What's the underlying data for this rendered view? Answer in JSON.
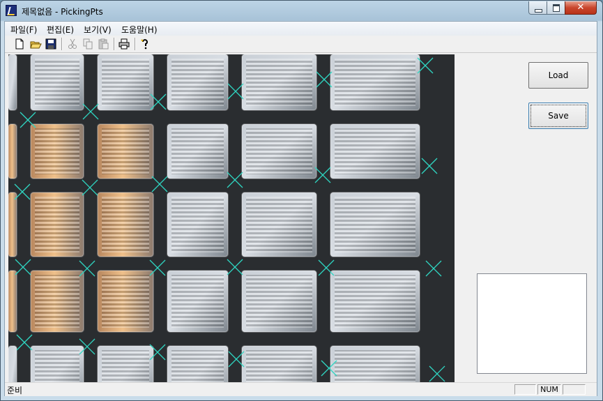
{
  "window": {
    "title": "제목없음 - PickingPts"
  },
  "window_controls": {
    "close_glyph": "✕"
  },
  "menu": [
    "파일(F)",
    "편집(E)",
    "보기(V)",
    "도움말(H)"
  ],
  "toolbar": [
    "new-icon",
    "open-icon",
    "save-icon",
    "cut-icon",
    "copy-icon",
    "paste-icon",
    "print-icon",
    "help-icon"
  ],
  "buttons": {
    "load": "Load",
    "save": "Save"
  },
  "status": {
    "text": "준비",
    "pane1": "",
    "num": "NUM",
    "pane3": ""
  },
  "colors": {
    "marker": "#2fd6c2",
    "glass_light": "#d8dde3",
    "grout": "#2a2d30"
  }
}
